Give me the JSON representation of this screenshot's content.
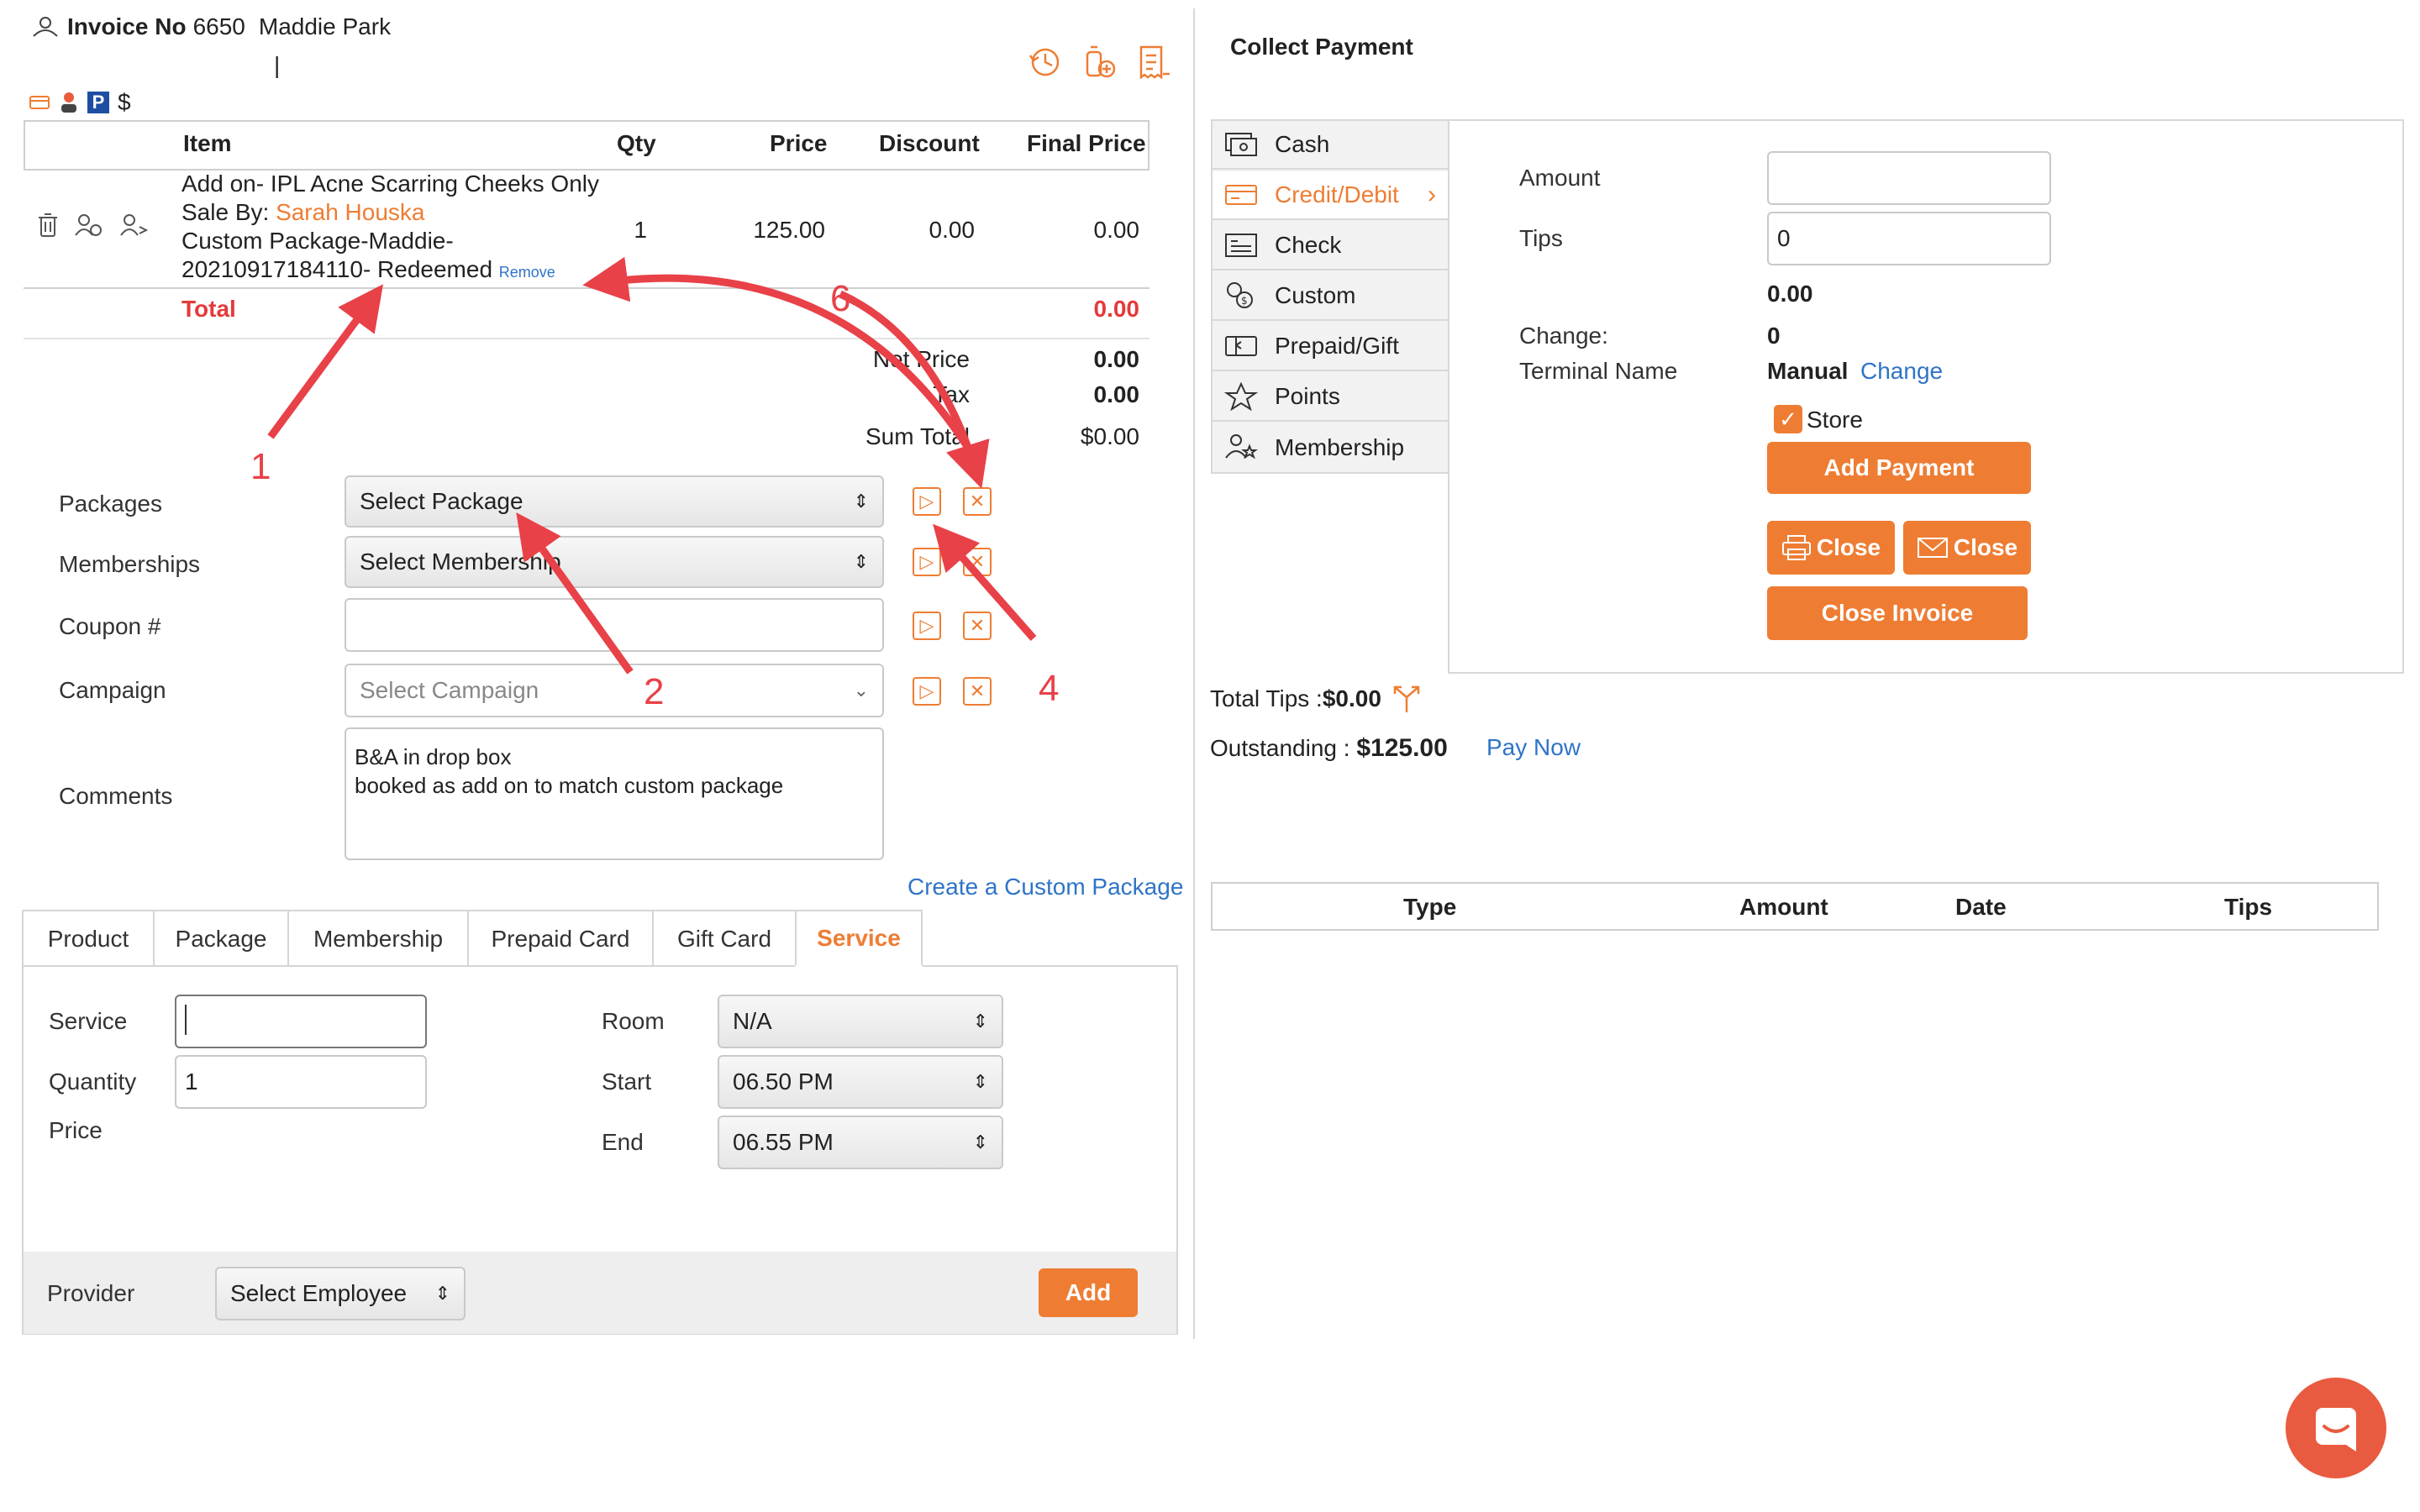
{
  "invoice": {
    "label": "Invoice No",
    "number": "6650",
    "customer": "Maddie Park",
    "cursor_line": "|",
    "badge_p": "P",
    "badge_dollar": "$"
  },
  "items_table": {
    "headers": [
      "Item",
      "Qty",
      "Price",
      "Discount",
      "Final Price"
    ],
    "row": {
      "name": "Add on- IPL Acne Scarring Cheeks Only",
      "sale_by_label": "Sale By:",
      "sale_by_name": "Sarah Houska",
      "package_line1": "Custom Package-Maddie-",
      "package_line2": "20210917184110- Redeemed",
      "remove_link": "Remove",
      "qty": "1",
      "price": "125.00",
      "discount": "0.00",
      "final_price": "0.00"
    },
    "total_label": "Total",
    "total_value": "0.00"
  },
  "summary": {
    "net_price_label": "Net Price",
    "net_price": "0.00",
    "tax_label": "Tax",
    "tax": "0.00",
    "sum_total_label": "Sum Total",
    "sum_total": "$0.00"
  },
  "form": {
    "packages_label": "Packages",
    "packages_value": "Select Package",
    "memberships_label": "Memberships",
    "memberships_value": "Select Membership",
    "coupon_label": "Coupon #",
    "coupon_value": "",
    "campaign_label": "Campaign",
    "campaign_value": "Select Campaign",
    "comments_label": "Comments",
    "comments_line1": "B&A in drop box",
    "comments_line2": "booked as add on to match custom package",
    "create_custom_package": "Create a Custom Package"
  },
  "tabs": [
    "Product",
    "Package",
    "Membership",
    "Prepaid Card",
    "Gift Card",
    "Service"
  ],
  "active_tab": "Service",
  "service_panel": {
    "service_label": "Service",
    "service_value": "",
    "quantity_label": "Quantity",
    "quantity_value": "1",
    "price_label": "Price",
    "room_label": "Room",
    "room_value": "N/A",
    "start_label": "Start",
    "start_value": "06.50 PM",
    "end_label": "End",
    "end_value": "06.55 PM",
    "provider_label": "Provider",
    "provider_value": "Select Employee",
    "add_button": "Add"
  },
  "collect_payment": {
    "title": "Collect Payment",
    "methods": [
      "Cash",
      "Credit/Debit",
      "Check",
      "Custom",
      "Prepaid/Gift",
      "Points",
      "Membership"
    ],
    "active_method": "Credit/Debit",
    "amount_label": "Amount",
    "amount_value": "",
    "tips_label": "Tips",
    "tips_value": "0",
    "subtotal": "0.00",
    "change_label": "Change:",
    "change_value": "0",
    "terminal_label": "Terminal Name",
    "terminal_value": "Manual",
    "terminal_change_link": "Change",
    "store_label": "Store",
    "store_checked": true,
    "add_payment": "Add Payment",
    "close_print": "Close",
    "close_email": "Close",
    "close_invoice": "Close Invoice",
    "total_tips_label": "Total Tips :",
    "total_tips_value": "$0.00",
    "outstanding_label": "Outstanding :",
    "outstanding_value": "$125.00",
    "pay_now": "Pay Now",
    "payments_headers": [
      "Type",
      "Amount",
      "Date",
      "Tips"
    ]
  },
  "annotations": [
    "1",
    "2",
    "4",
    "6"
  ],
  "colors": {
    "accent": "#ee7d33",
    "total_red": "#e53a3a",
    "link_blue": "#2f74c7",
    "annotation_red": "#e84148"
  }
}
